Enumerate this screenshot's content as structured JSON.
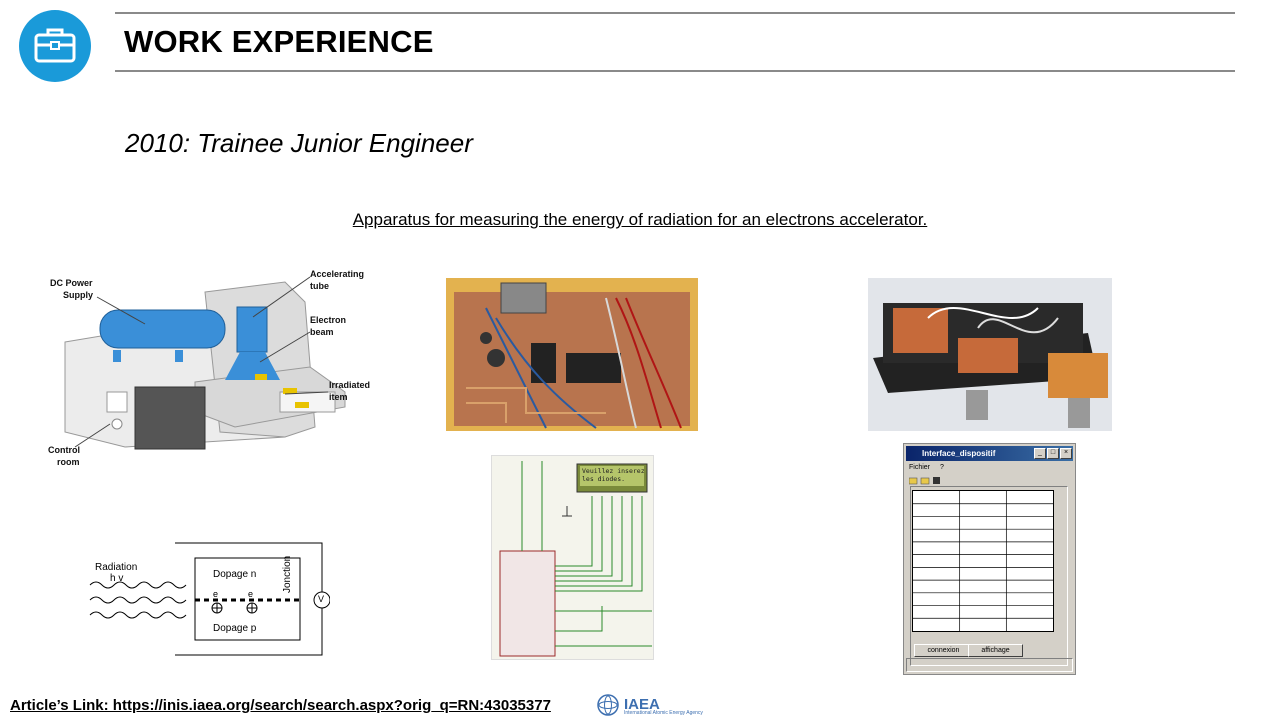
{
  "header": {
    "title": "WORK EXPERIENCE",
    "icon": "briefcase-icon",
    "accent_color": "#1a9ad9"
  },
  "role": "2010: Trainee Junior Engineer",
  "caption": "Apparatus for measuring the energy of radiation for an electrons accelerator.",
  "accelerator_diagram": {
    "labels": {
      "dc_power": "DC Power",
      "supply": "Supply",
      "accelerating": "Accelerating",
      "tube": "tube",
      "electron": "Electron",
      "beam": "beam",
      "irradiated": "Irradiated",
      "item": "item",
      "control": "Control",
      "room": "room"
    }
  },
  "junction_diagram": {
    "radiation": "Radiation",
    "hv": "h v",
    "dopage_n": "Dopage n",
    "dopage_p": "Dopage p",
    "electron": "e",
    "jonction": "Jonction",
    "voltmeter": "V"
  },
  "schematic": {
    "lcd_line1": "Veuillez inserez",
    "lcd_line2": "les diodes."
  },
  "app_window": {
    "title": "Interface_dispositif",
    "menu": [
      "Fichier",
      "?"
    ],
    "buttons": {
      "connexion": "connexion",
      "affichage": "affichage"
    },
    "grid_rows": 11,
    "grid_cols": 3
  },
  "footer": {
    "link_text": "Article’s Link: https://inis.iaea.org/search/search.aspx?orig_q=RN:43035377",
    "org": "IAEA",
    "org_full": "International Atomic Energy Agency"
  }
}
